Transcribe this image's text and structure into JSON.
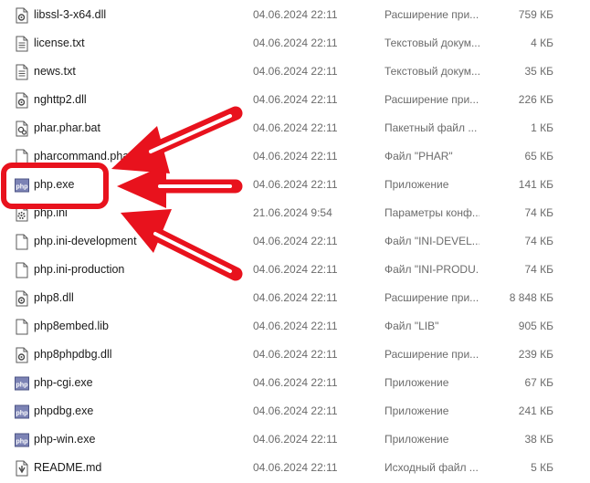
{
  "files": [
    {
      "name": "libssl-3-x64.dll",
      "date": "04.06.2024 22:11",
      "type": "Расширение при...",
      "size": "759 КБ",
      "icon": "dll-icon"
    },
    {
      "name": "license.txt",
      "date": "04.06.2024 22:11",
      "type": "Текстовый докум...",
      "size": "4 КБ",
      "icon": "text-file-icon"
    },
    {
      "name": "news.txt",
      "date": "04.06.2024 22:11",
      "type": "Текстовый докум...",
      "size": "35 КБ",
      "icon": "text-file-icon"
    },
    {
      "name": "nghttp2.dll",
      "date": "04.06.2024 22:11",
      "type": "Расширение при...",
      "size": "226 КБ",
      "icon": "dll-icon"
    },
    {
      "name": "phar.phar.bat",
      "date": "04.06.2024 22:11",
      "type": "Пакетный файл ...",
      "size": "1 КБ",
      "icon": "batch-file-icon"
    },
    {
      "name": "pharcommand.phar",
      "date": "04.06.2024 22:11",
      "type": "Файл \"PHAR\"",
      "size": "65 КБ",
      "icon": "blank-file-icon"
    },
    {
      "name": "php.exe",
      "date": "04.06.2024 22:11",
      "type": "Приложение",
      "size": "141 КБ",
      "icon": "php-exe-icon"
    },
    {
      "name": "php.ini",
      "date": "21.06.2024 9:54",
      "type": "Параметры конф...",
      "size": "74 КБ",
      "icon": "config-file-icon"
    },
    {
      "name": "php.ini-development",
      "date": "04.06.2024 22:11",
      "type": "Файл \"INI-DEVEL...",
      "size": "74 КБ",
      "icon": "blank-file-icon"
    },
    {
      "name": "php.ini-production",
      "date": "04.06.2024 22:11",
      "type": "Файл \"INI-PRODU...",
      "size": "74 КБ",
      "icon": "blank-file-icon"
    },
    {
      "name": "php8.dll",
      "date": "04.06.2024 22:11",
      "type": "Расширение при...",
      "size": "8 848 КБ",
      "icon": "dll-icon"
    },
    {
      "name": "php8embed.lib",
      "date": "04.06.2024 22:11",
      "type": "Файл \"LIB\"",
      "size": "905 КБ",
      "icon": "blank-file-icon"
    },
    {
      "name": "php8phpdbg.dll",
      "date": "04.06.2024 22:11",
      "type": "Расширение при...",
      "size": "239 КБ",
      "icon": "dll-icon"
    },
    {
      "name": "php-cgi.exe",
      "date": "04.06.2024 22:11",
      "type": "Приложение",
      "size": "67 КБ",
      "icon": "php-exe-icon"
    },
    {
      "name": "phpdbg.exe",
      "date": "04.06.2024 22:11",
      "type": "Приложение",
      "size": "241 КБ",
      "icon": "php-exe-icon"
    },
    {
      "name": "php-win.exe",
      "date": "04.06.2024 22:11",
      "type": "Приложение",
      "size": "38 КБ",
      "icon": "php-exe-icon"
    },
    {
      "name": "README.md",
      "date": "04.06.2024 22:11",
      "type": "Исходный файл ...",
      "size": "5 КБ",
      "icon": "markdown-file-icon"
    }
  ],
  "php_icon_text": "php",
  "colors": {
    "annotation": "#e8121d",
    "date_text": "#6b6b6b",
    "php_icon": "#7c83b5"
  },
  "highlighted_file": "php.exe"
}
